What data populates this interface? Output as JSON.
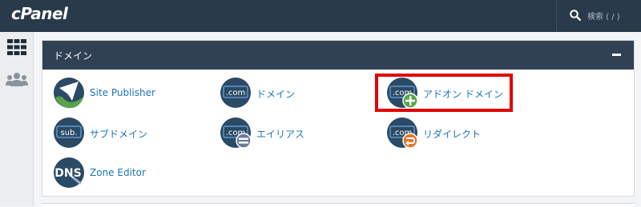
{
  "app": {
    "logo_text": "cPanel"
  },
  "topbar": {
    "search_placeholder": "検索 ( / )"
  },
  "colors": {
    "topbar_bg": "#293a4a",
    "panel_header_bg": "#2f4152",
    "link": "#1e75b8",
    "highlight": "#e00000"
  },
  "panel": {
    "title": "ドメイン",
    "items": [
      {
        "label": "Site Publisher",
        "icon": "site-publisher-icon"
      },
      {
        "label": "ドメイン",
        "icon": "domains-com-icon"
      },
      {
        "label": "アドオン ドメイン",
        "icon": "addon-domains-icon"
      },
      {
        "label": "サブドメイン",
        "icon": "subdomains-icon",
        "icon_text": "sub."
      },
      {
        "label": "エイリアス",
        "icon": "aliases-icon"
      },
      {
        "label": "リダイレクト",
        "icon": "redirects-icon"
      },
      {
        "label": "Zone Editor",
        "icon": "zone-editor-icon",
        "icon_text": "DNS"
      }
    ],
    "com_text": ".com"
  }
}
